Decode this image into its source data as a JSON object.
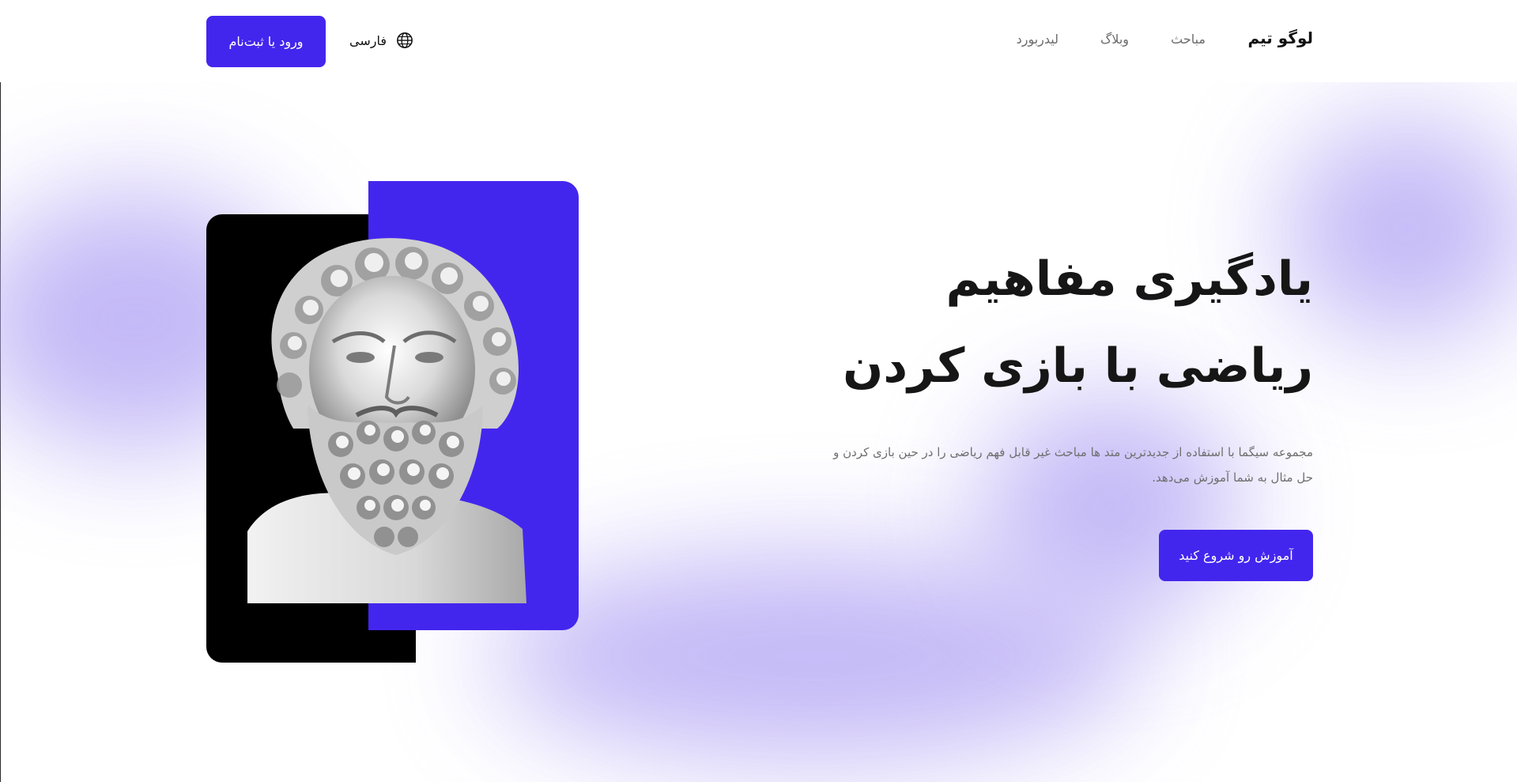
{
  "header": {
    "logo": "لوگو تیم",
    "nav": [
      {
        "label": "مباحث"
      },
      {
        "label": "وبلاگ"
      },
      {
        "label": "لیدربورد"
      }
    ],
    "language": {
      "label": "فارسی",
      "icon": "globe-icon"
    },
    "login_label": "ورود یا ثبت‌نام"
  },
  "hero": {
    "title_line1": "یادگیری مفاهیم",
    "title_line2": "ریاضی با بازی کردن",
    "description": "مجموعه سیگما با استفاده از جدیدترین متد ها مباحث غیر قابل فهم ریاضی را در حین بازی کردن و حل مثال به شما آموزش می‌دهد.",
    "cta_label": "آموزش رو شروع کنید",
    "image": "marble-bust-illustration"
  },
  "colors": {
    "accent": "#4326ee",
    "glow": "#b9adf5",
    "dark": "#000000"
  }
}
